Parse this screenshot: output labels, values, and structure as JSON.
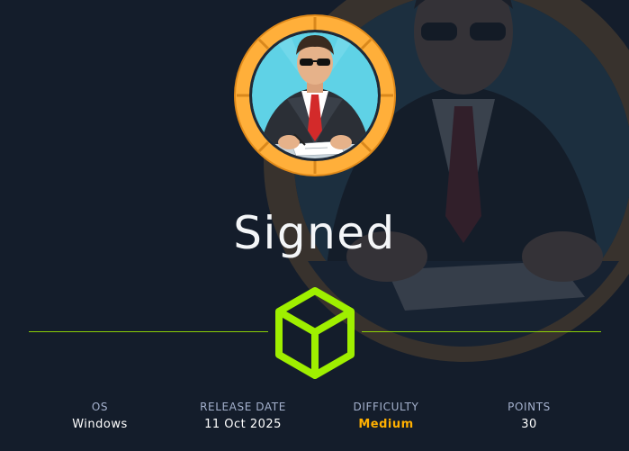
{
  "machine": {
    "name": "Signed",
    "avatar_icon": "businessman-signing-icon",
    "os_icon": "cube-icon"
  },
  "stats": {
    "os": {
      "label": "OS",
      "value": "Windows"
    },
    "release_date": {
      "label": "RELEASE DATE",
      "value": "11 Oct 2025"
    },
    "difficulty": {
      "label": "DIFFICULTY",
      "value": "Medium"
    },
    "points": {
      "label": "POINTS",
      "value": "30"
    }
  },
  "colors": {
    "background": "#141d2b",
    "accent_green": "#9fef00",
    "ring_orange": "#ffaf3a",
    "difficulty_medium": "#ffaf00",
    "label_gray": "#a4b1cd"
  }
}
